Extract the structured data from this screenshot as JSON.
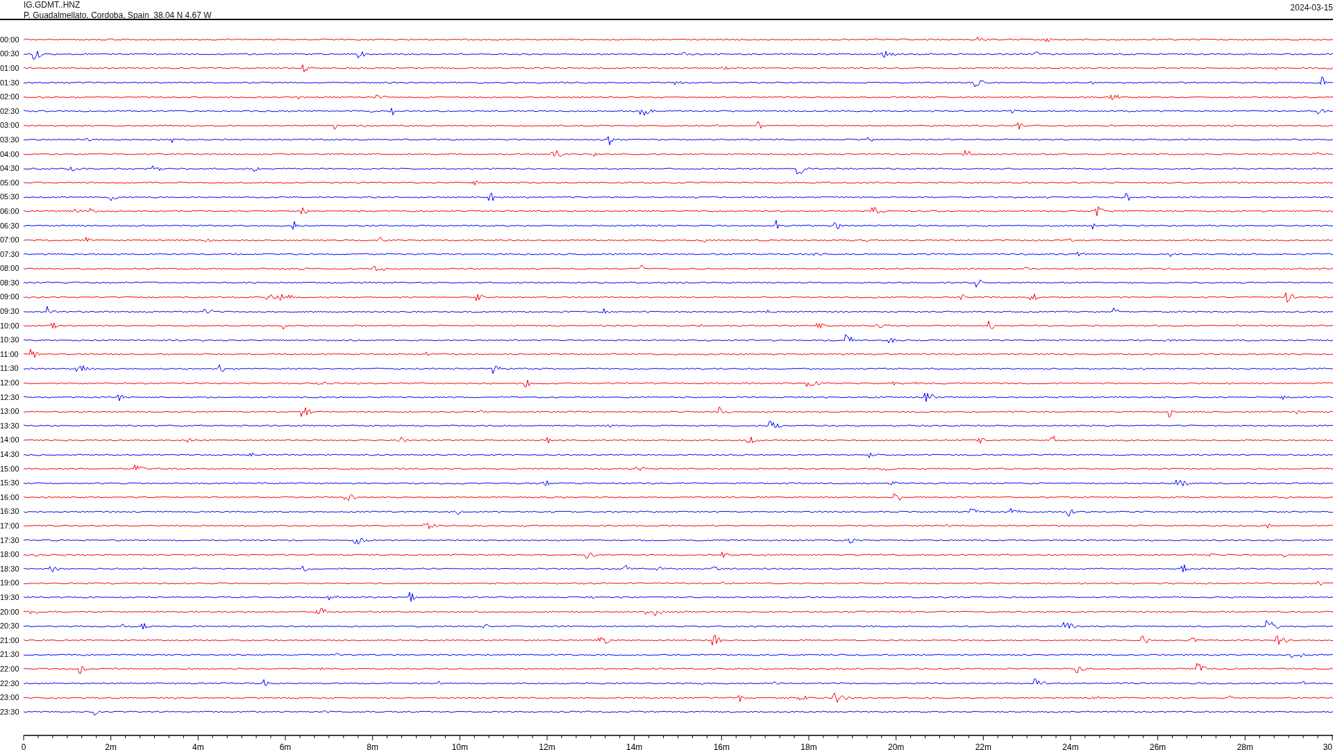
{
  "header": {
    "channel": "IG.GDMT..HNZ",
    "station": "P. Guadalmellato, Cordoba, Spain  38.04 N 4.67 W",
    "date": "2024-03-15"
  },
  "rows": [
    {
      "label": "00:00",
      "color": "#ff0000"
    },
    {
      "label": "00:30",
      "color": "#0000ff"
    },
    {
      "label": "01:00",
      "color": "#ff0000"
    },
    {
      "label": "01:30",
      "color": "#0000ff"
    },
    {
      "label": "02:00",
      "color": "#ff0000"
    },
    {
      "label": "02:30",
      "color": "#0000ff"
    },
    {
      "label": "03:00",
      "color": "#ff0000"
    },
    {
      "label": "03:30",
      "color": "#0000ff"
    },
    {
      "label": "04:00",
      "color": "#ff0000"
    },
    {
      "label": "04:30",
      "color": "#0000ff"
    },
    {
      "label": "05:00",
      "color": "#ff0000"
    },
    {
      "label": "05:30",
      "color": "#0000ff"
    },
    {
      "label": "06:00",
      "color": "#ff0000"
    },
    {
      "label": "06:30",
      "color": "#0000ff"
    },
    {
      "label": "07:00",
      "color": "#ff0000"
    },
    {
      "label": "07:30",
      "color": "#0000ff"
    },
    {
      "label": "08:00",
      "color": "#ff0000"
    },
    {
      "label": "08:30",
      "color": "#0000ff"
    },
    {
      "label": "09:00",
      "color": "#ff0000"
    },
    {
      "label": "09:30",
      "color": "#0000ff"
    },
    {
      "label": "10:00",
      "color": "#ff0000"
    },
    {
      "label": "10:30",
      "color": "#0000ff"
    },
    {
      "label": "11:00",
      "color": "#ff0000"
    },
    {
      "label": "11:30",
      "color": "#0000ff"
    },
    {
      "label": "12:00",
      "color": "#ff0000"
    },
    {
      "label": "12:30",
      "color": "#0000ff"
    },
    {
      "label": "13:00",
      "color": "#ff0000"
    },
    {
      "label": "13:30",
      "color": "#0000ff"
    },
    {
      "label": "14:00",
      "color": "#ff0000"
    },
    {
      "label": "14:30",
      "color": "#0000ff"
    },
    {
      "label": "15:00",
      "color": "#ff0000"
    },
    {
      "label": "15:30",
      "color": "#0000ff"
    },
    {
      "label": "16:00",
      "color": "#ff0000"
    },
    {
      "label": "16:30",
      "color": "#0000ff"
    },
    {
      "label": "17:00",
      "color": "#ff0000"
    },
    {
      "label": "17:30",
      "color": "#0000ff"
    },
    {
      "label": "18:00",
      "color": "#ff0000"
    },
    {
      "label": "18:30",
      "color": "#0000ff"
    },
    {
      "label": "19:00",
      "color": "#ff0000"
    },
    {
      "label": "19:30",
      "color": "#0000ff"
    },
    {
      "label": "20:00",
      "color": "#ff0000"
    },
    {
      "label": "20:30",
      "color": "#0000ff"
    },
    {
      "label": "21:00",
      "color": "#ff0000"
    },
    {
      "label": "21:30",
      "color": "#0000ff"
    },
    {
      "label": "22:00",
      "color": "#ff0000"
    },
    {
      "label": "22:30",
      "color": "#0000ff"
    },
    {
      "label": "23:00",
      "color": "#ff0000"
    },
    {
      "label": "23:30",
      "color": "#0000ff"
    }
  ],
  "x_axis": {
    "ticks": [
      "0",
      "2m",
      "4m",
      "6m",
      "8m",
      "10m",
      "12m",
      "14m",
      "16m",
      "18m",
      "20m",
      "22m",
      "24m",
      "26m",
      "28m",
      "30"
    ]
  }
}
